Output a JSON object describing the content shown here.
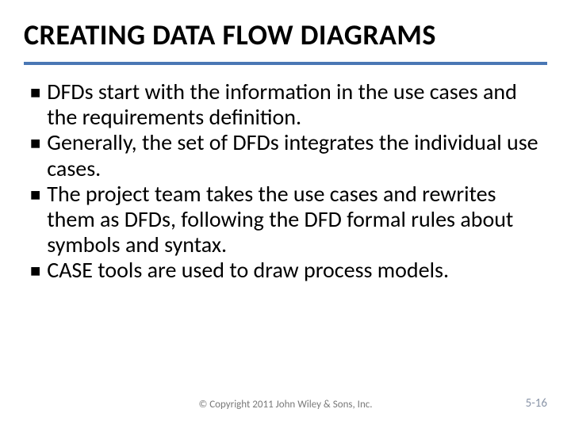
{
  "title": "CREATING DATA FLOW DIAGRAMS",
  "bullets": [
    "DFDs start with the information in the use cases and the requirements definition.",
    "Generally, the set of DFDs integrates the individual use cases.",
    "The project team takes the use cases and rewrites them as DFDs, following the DFD formal rules about symbols and syntax.",
    "CASE tools are used to draw process models."
  ],
  "footer": {
    "copyright": "© Copyright 2011 John Wiley & Sons, Inc.",
    "page": "5-16"
  }
}
